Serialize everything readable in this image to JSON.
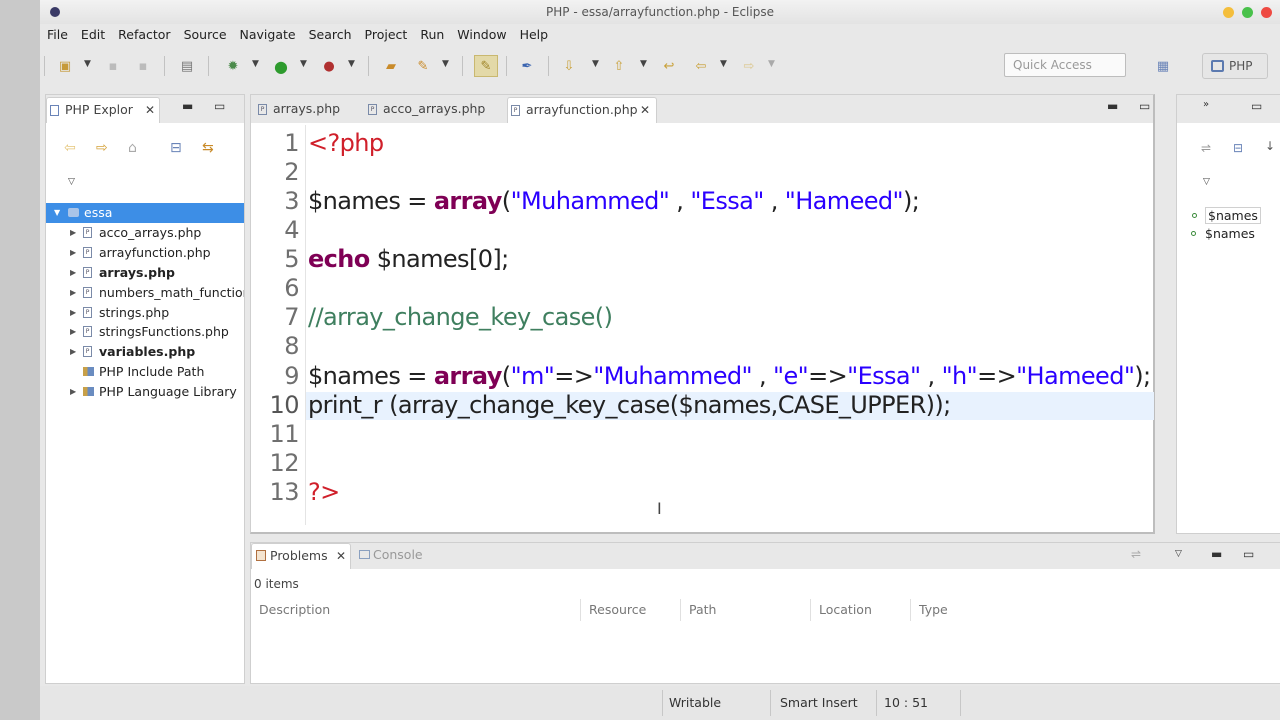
{
  "window": {
    "title": "PHP - essa/arrayfunction.php - Eclipse"
  },
  "menu": [
    "File",
    "Edit",
    "Refactor",
    "Source",
    "Navigate",
    "Search",
    "Project",
    "Run",
    "Window",
    "Help"
  ],
  "toolbar": {
    "quick_access_placeholder": "Quick Access",
    "perspective_label": "PHP"
  },
  "explorer": {
    "tab_label": "PHP Explor",
    "project": "essa",
    "items": [
      {
        "label": "acco_arrays.php",
        "bold": false
      },
      {
        "label": "arrayfunction.php",
        "bold": false
      },
      {
        "label": "arrays.php",
        "bold": true
      },
      {
        "label": "numbers_math_functior",
        "bold": false
      },
      {
        "label": "strings.php",
        "bold": false
      },
      {
        "label": "stringsFunctions.php",
        "bold": false
      },
      {
        "label": "variables.php",
        "bold": true
      },
      {
        "label": "PHP Include Path",
        "bold": false
      },
      {
        "label": "PHP Language Library",
        "bold": false
      }
    ]
  },
  "editor": {
    "tabs": [
      "arrays.php",
      "acco_arrays.php",
      "arrayfunction.php"
    ],
    "active_tab": "arrayfunction.php",
    "line_numbers": [
      "1",
      "2",
      "3",
      "4",
      "5",
      "6",
      "7",
      "8",
      "9",
      "10",
      "11",
      "12",
      "13"
    ],
    "code": {
      "l1_tag": "<?php",
      "l3_var": "$names = ",
      "l3_kw": "array",
      "l3_open": "(",
      "l3_s1": "\"Muhammed\"",
      "l3_sep1": " , ",
      "l3_s2": "\"Essa\"",
      "l3_sep2": " , ",
      "l3_s3": "\"Hameed\"",
      "l3_close": ");",
      "l5_kw": "echo",
      "l5_rest": " $names[0];",
      "l7_comment": "//array_change_key_case()",
      "l9_var": "$names = ",
      "l9_kw": "array",
      "l9_open": "(",
      "l9_k1": "\"m\"",
      "l9_arrow1": "=>",
      "l9_v1": "\"Muhammed\"",
      "l9_sep1": " , ",
      "l9_k2": "\"e\"",
      "l9_arrow2": "=>",
      "l9_v2": "\"Essa\"",
      "l9_sep2": " , ",
      "l9_k3": "\"h\"",
      "l9_arrow3": "=>",
      "l9_v3": "\"Hameed\"",
      "l9_close": ");",
      "l10_text": "print_r (array_change_key_case($names,CASE_UPPER));",
      "l13_tag": "?>"
    }
  },
  "outline": {
    "items": [
      "$names",
      "$names"
    ]
  },
  "problems": {
    "tab_label": "Problems",
    "console_label": "Console",
    "count_text": "0 items",
    "columns": [
      "Description",
      "Resource",
      "Path",
      "Location",
      "Type"
    ]
  },
  "status": {
    "writable": "Writable",
    "insert_mode": "Smart Insert",
    "position": "10 : 51"
  },
  "colors": {
    "keyword": "#7f0055",
    "string": "#2a00ff",
    "comment": "#3f7f5f",
    "php_tag": "#d01f2a",
    "selection": "#3d8ee6"
  }
}
